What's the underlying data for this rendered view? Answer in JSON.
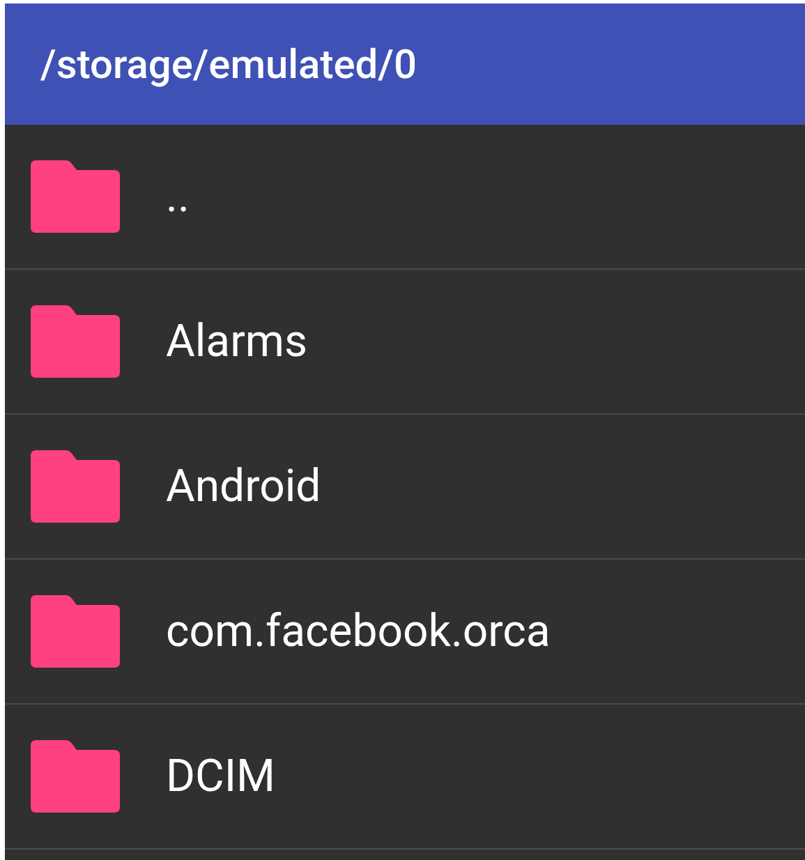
{
  "toolbar": {
    "title": "/storage/emulated/0"
  },
  "items": [
    {
      "name": ".."
    },
    {
      "name": "Alarms"
    },
    {
      "name": "Android"
    },
    {
      "name": "com.facebook.orca"
    },
    {
      "name": "DCIM"
    }
  ]
}
